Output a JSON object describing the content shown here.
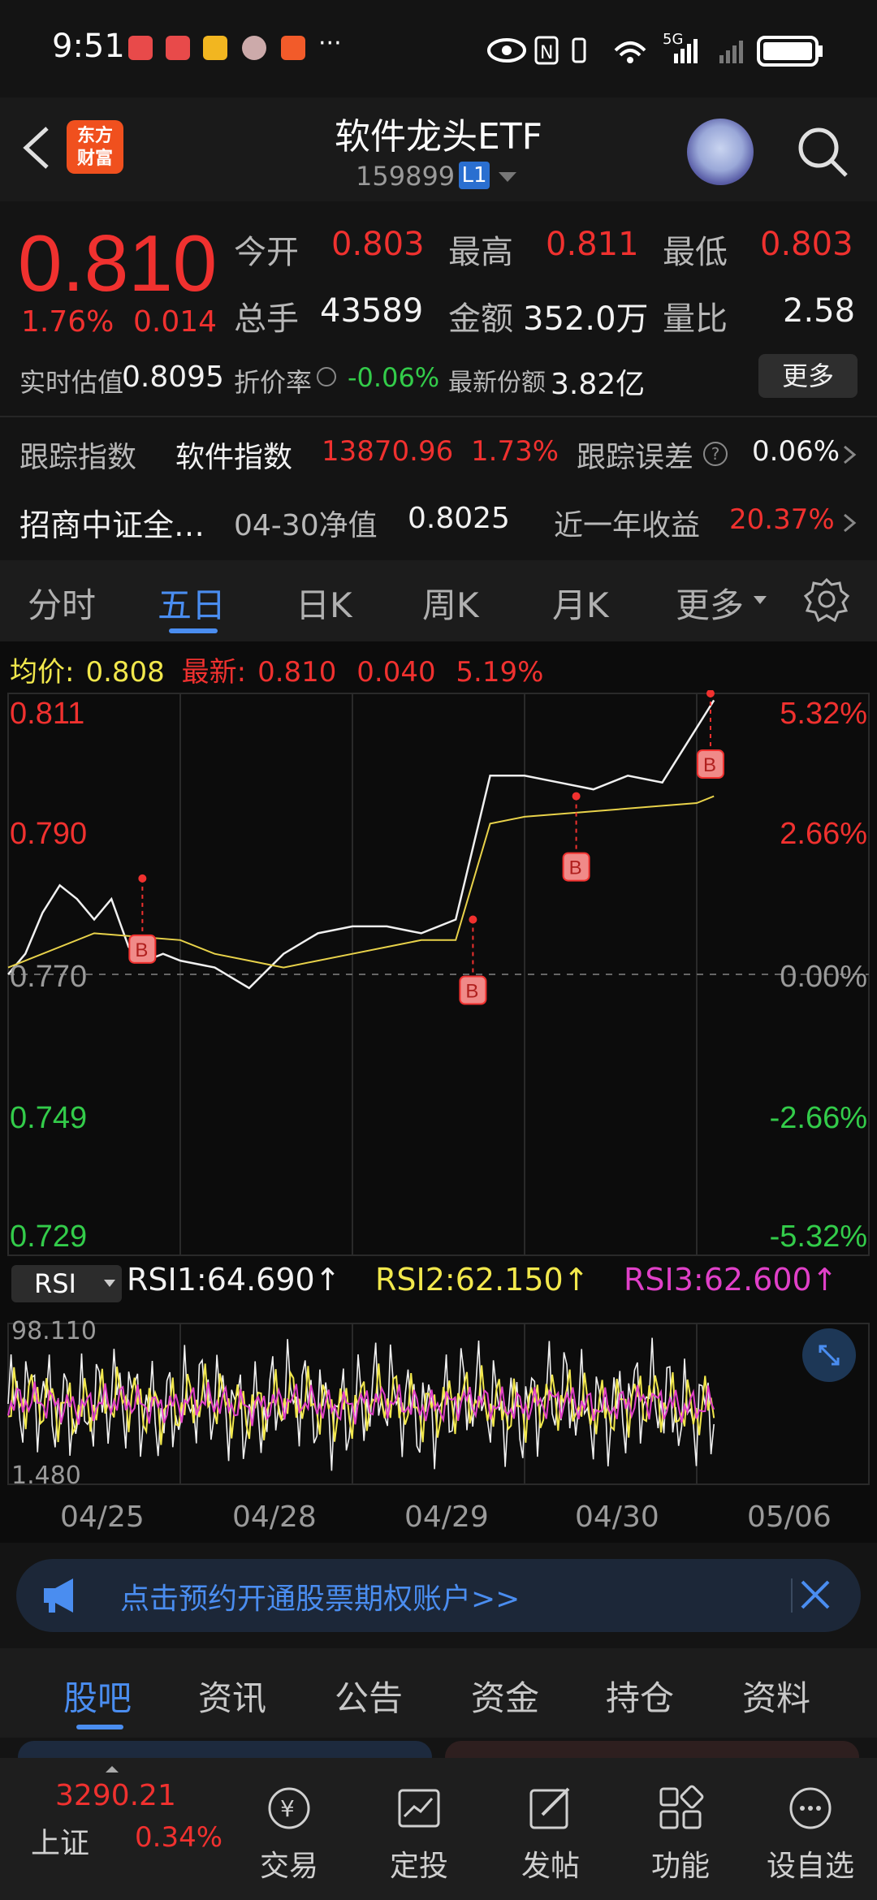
{
  "status": {
    "time": "9:51",
    "more": "···",
    "net": "5G"
  },
  "header": {
    "brand_line1": "东方",
    "brand_line2": "财富",
    "title": "软件龙头ETF",
    "code": "159899",
    "level": "L1"
  },
  "quote": {
    "price": "0.810",
    "change_pct": "1.76%",
    "change": "0.014",
    "open_label": "今开",
    "open": "0.803",
    "high_label": "最高",
    "high": "0.811",
    "low_label": "最低",
    "low": "0.803",
    "volume_label": "总手",
    "volume": "43589",
    "amount_label": "金额",
    "amount": "352.0万",
    "vol_ratio_label": "量比",
    "vol_ratio": "2.58",
    "iopv_label": "实时估值",
    "iopv": "0.8095",
    "discount_label": "折价率",
    "discount": "-0.06%",
    "shares_label": "最新份额",
    "shares": "3.82亿",
    "more_button": "更多",
    "track_label": "跟踪指数",
    "track_index": "软件指数",
    "track_value": "13870.96",
    "track_pct": "1.73%",
    "track_err_label": "跟踪误差",
    "track_err": "0.06%",
    "fund_name": "招商中证全…",
    "nav_label": "04-30净值",
    "nav": "0.8025",
    "year_label": "近一年收益",
    "year_return": "20.37%"
  },
  "ktabs": [
    "分时",
    "五日",
    "日K",
    "周K",
    "月K",
    "更多"
  ],
  "ktab_active": "五日",
  "chart_info": {
    "avg_label": "均价:",
    "avg": "0.808",
    "last_label": "最新:",
    "last": "0.810",
    "chg": "0.040",
    "chg_pct": "5.19%"
  },
  "colors": {
    "up": "#f0312f",
    "down": "#33cc4a",
    "accent": "#4a8df0",
    "avg_line": "#e8d24a",
    "rsi2": "#f2e84c",
    "rsi3": "#e040c8"
  },
  "chart_data": {
    "type": "line",
    "title": "",
    "x_dates": [
      "04/25",
      "04/28",
      "04/29",
      "04/30",
      "05/06"
    ],
    "y_left_ticks": [
      "0.811",
      "0.790",
      "0.770",
      "0.749",
      "0.729"
    ],
    "y_right_ticks": [
      "5.32%",
      "2.66%",
      "0.00%",
      "-2.66%",
      "-5.32%"
    ],
    "ylim": [
      0.729,
      0.811
    ],
    "prev_close": 0.77,
    "series": [
      {
        "type": "price",
        "x": [
          0,
          0.1,
          0.2,
          0.3,
          0.4,
          0.5,
          0.6,
          0.7,
          0.8,
          0.9,
          1,
          1.2,
          1.4,
          1.6,
          1.8,
          2,
          2.2,
          2.4,
          2.6,
          2.8,
          3,
          3.2,
          3.4,
          3.6,
          3.8,
          4,
          4.1
        ],
        "values": [
          0.77,
          0.773,
          0.779,
          0.783,
          0.781,
          0.778,
          0.781,
          0.774,
          0.772,
          0.773,
          0.772,
          0.771,
          0.768,
          0.773,
          0.776,
          0.777,
          0.777,
          0.776,
          0.778,
          0.799,
          0.799,
          0.798,
          0.797,
          0.799,
          0.798,
          0.806,
          0.81
        ]
      },
      {
        "type": "avg",
        "x": [
          0,
          0.5,
          1,
          1.2,
          1.4,
          1.6,
          1.8,
          2,
          2.2,
          2.4,
          2.6,
          2.8,
          3,
          3.5,
          4,
          4.1
        ],
        "values": [
          0.771,
          0.776,
          0.775,
          0.773,
          0.772,
          0.771,
          0.772,
          0.773,
          0.774,
          0.775,
          0.775,
          0.792,
          0.793,
          0.794,
          0.795,
          0.796
        ]
      }
    ],
    "markers": [
      {
        "x": 0.78,
        "y": 0.784,
        "label": "B"
      },
      {
        "x": 2.7,
        "y": 0.778,
        "label": "B"
      },
      {
        "x": 3.3,
        "y": 0.796,
        "label": "B"
      },
      {
        "x": 4.08,
        "y": 0.811,
        "label": "B"
      }
    ]
  },
  "rsi": {
    "select": "RSI",
    "rsi1": "RSI1:64.690↑",
    "rsi2": "RSI2:62.150↑",
    "rsi3": "RSI3:62.600↑",
    "top": "98.110",
    "bottom": "1.480"
  },
  "banner": {
    "text": "点击预约开通股票期权账户>>"
  },
  "ntabs": [
    "股吧",
    "资讯",
    "公告",
    "资金",
    "持仓",
    "资料"
  ],
  "ntab_active": "股吧",
  "nav": {
    "index_value": "3290.21",
    "index_name": "上证",
    "index_pct": "0.34%",
    "items": [
      "交易",
      "定投",
      "发帖",
      "功能",
      "设自选"
    ]
  }
}
